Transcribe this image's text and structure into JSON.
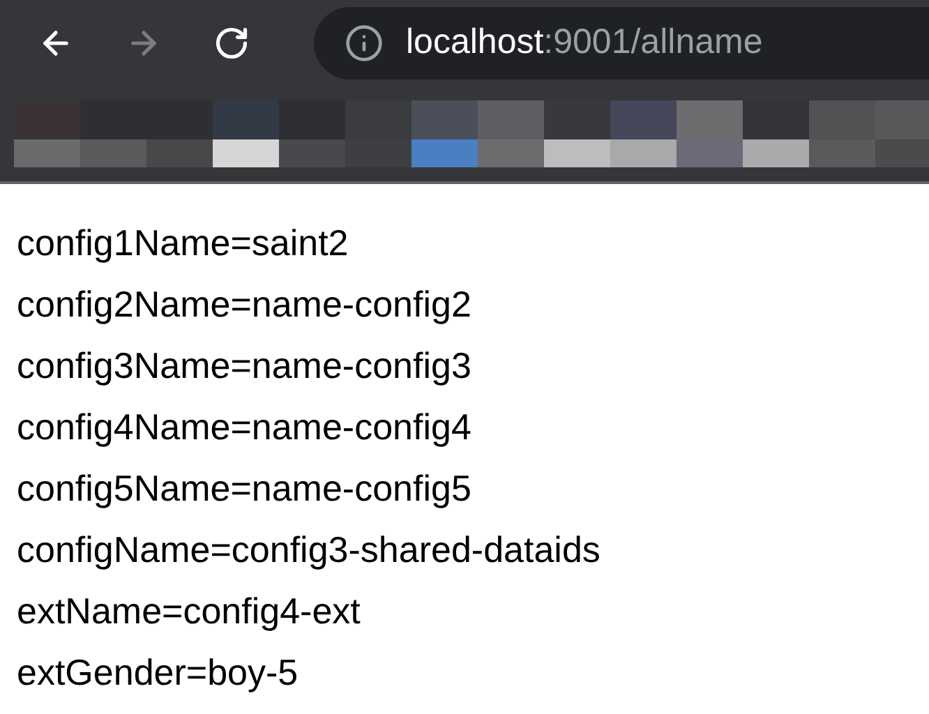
{
  "toolbar": {
    "buttons": [
      {
        "kind": "back",
        "disabled": false
      },
      {
        "kind": "forward",
        "disabled": true
      },
      {
        "kind": "reload",
        "disabled": false
      }
    ],
    "address": {
      "host": "localhost",
      "rest": ":9001/allname"
    }
  },
  "lines": [
    "config1Name=saint2",
    "config2Name=name-config2",
    "config3Name=name-config3",
    "config4Name=name-config4",
    "config5Name=name-config5",
    "configName=config3-shared-dataids",
    "extName=config4-ext",
    "extGender=boy-5"
  ]
}
